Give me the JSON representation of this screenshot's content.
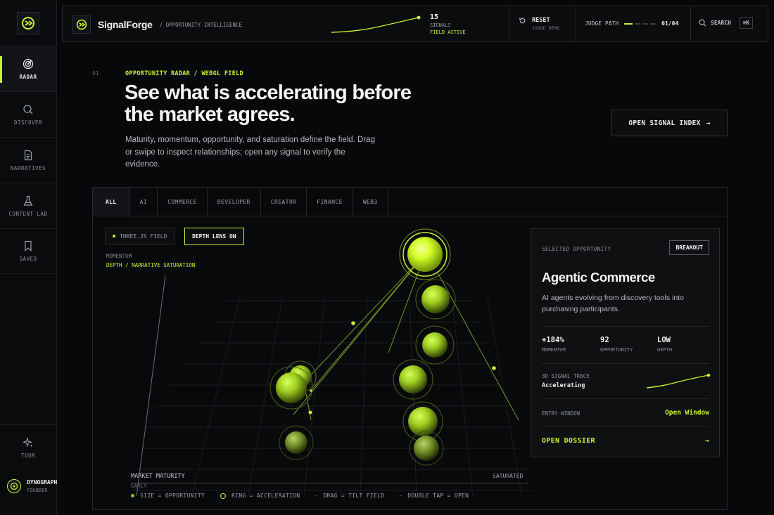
{
  "rail": {
    "items": [
      {
        "label": "RADAR",
        "icon": "radar-icon"
      },
      {
        "label": "DISCOVER",
        "icon": "search-icon"
      },
      {
        "label": "NARRATIVES",
        "icon": "document-icon"
      },
      {
        "label": "CONTENT LAB",
        "icon": "flask-icon"
      },
      {
        "label": "SAVED",
        "icon": "bookmark-icon"
      }
    ],
    "tour": "TOUR",
    "user": {
      "name": "DYNOGRAPH",
      "role": "FOUNDER"
    }
  },
  "topbar": {
    "brand": "SignalForge",
    "subtitle": "/ OPPORTUNITY INTELLIGENCE",
    "signals_count": "15",
    "signals_label": "SIGNALS",
    "field_status": "FIELD ACTIVE",
    "reset_label": "RESET",
    "reset_sub": "JUDGE DEMO",
    "judge_label": "JUDGE PATH",
    "judge_step": "01/04",
    "search_label": "SEARCH",
    "search_kbd": "⌘K"
  },
  "hero": {
    "step": "01",
    "eyebrow": "OPPORTUNITY RADAR / WEBGL FIELD",
    "headline": "See what is accelerating before the market agrees.",
    "lede": "Maturity, momentum, opportunity, and saturation define the field. Drag or swipe to inspect relationships; open any signal to verify the evidence.",
    "cta": "OPEN SIGNAL INDEX"
  },
  "tabs": [
    "ALL",
    "AI",
    "COMMERCE",
    "DEVELOPER",
    "CREATOR",
    "FINANCE",
    "WEB3"
  ],
  "field": {
    "chip_field": "THREE.JS FIELD",
    "chip_depth": "DEPTH LENS ON",
    "y_label": "MOMENTUM",
    "y_sub": "DEPTH / NARRATIVE SATURATION",
    "x_label": "MARKET MATURITY",
    "x_early": "EARLY",
    "x_end": "SATURATED",
    "legend": {
      "size": "SIZE = OPPORTUNITY",
      "ring": "RING = ACCELERATION",
      "drag": "DRAG = TILT FIELD",
      "tap": "DOUBLE TAP = OPEN"
    }
  },
  "card": {
    "eyebrow": "SELECTED OPPORTUNITY",
    "badge": "BREAKOUT",
    "title": "Agentic Commerce",
    "desc": "AI agents evolving from discovery tools into purchasing participants.",
    "stats": [
      {
        "value": "+184%",
        "label": "MOMENTUM"
      },
      {
        "value": "92",
        "label": "OPPORTUNITY"
      },
      {
        "value": "LOW",
        "label": "DEPTH"
      }
    ],
    "trace_label": "3D SIGNAL TRACE",
    "trace_value": "Accelerating",
    "entry_label": "ENTRY WINDOW",
    "entry_value": "Open Window",
    "dossier": "OPEN DOSSIER"
  },
  "colors": {
    "accent": "#c6f432",
    "bg": "#07080a",
    "panel": "#0e1012"
  }
}
